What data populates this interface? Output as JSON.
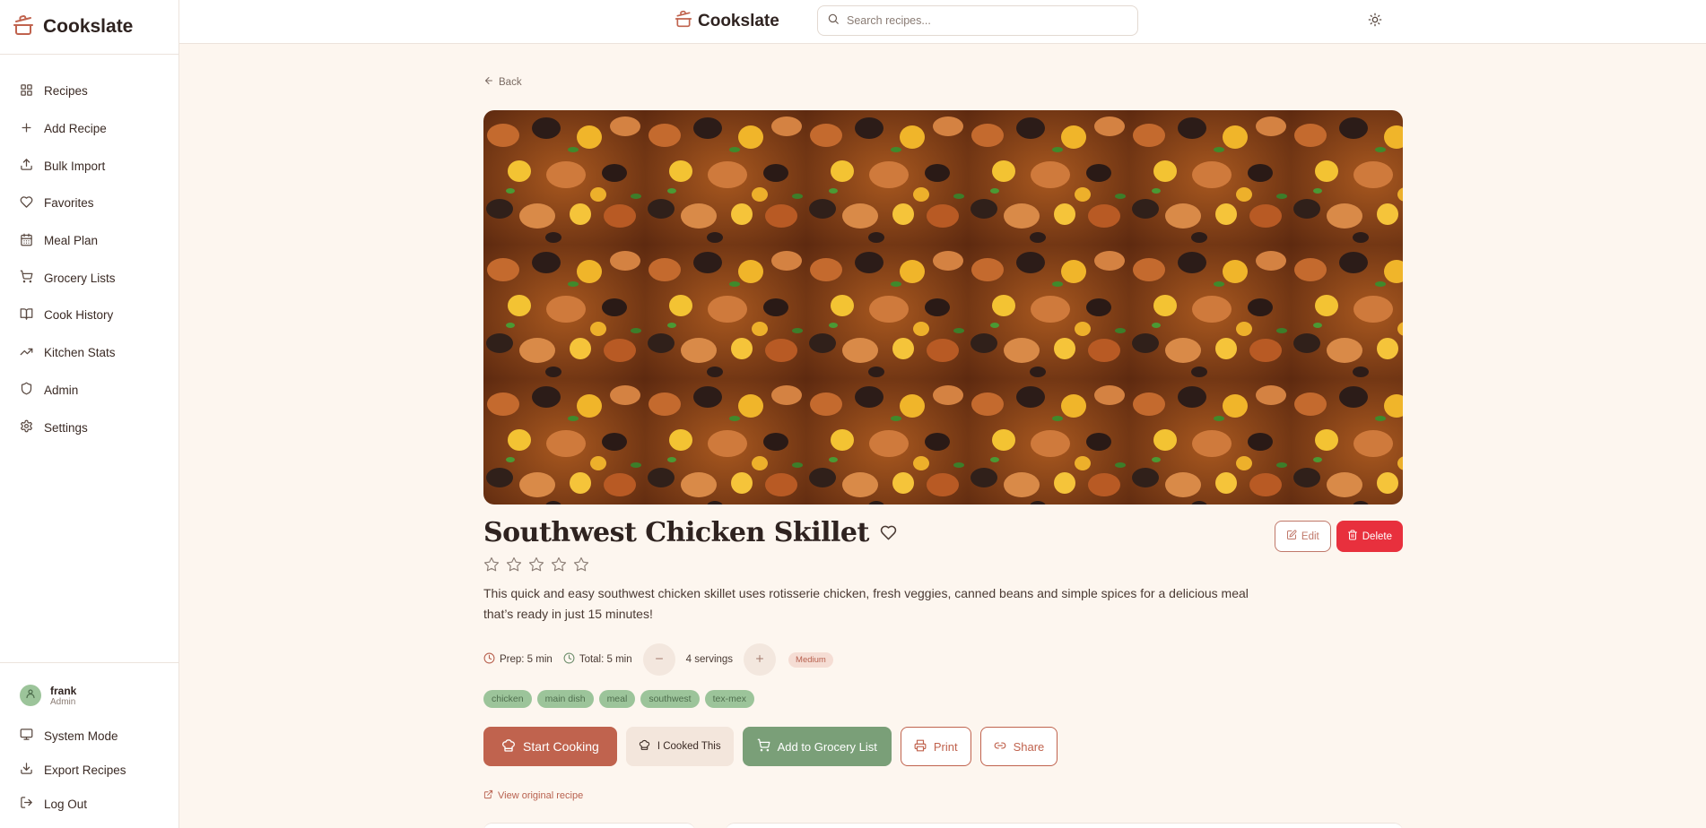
{
  "app": {
    "name": "Cookslate",
    "accent": "#c0634e",
    "icon": "cooking-pot-icon"
  },
  "sidebar": {
    "items": [
      {
        "label": "Recipes",
        "icon": "grid-icon"
      },
      {
        "label": "Add Recipe",
        "icon": "plus-icon"
      },
      {
        "label": "Bulk Import",
        "icon": "upload-icon"
      },
      {
        "label": "Favorites",
        "icon": "heart-icon"
      },
      {
        "label": "Meal Plan",
        "icon": "calendar-icon"
      },
      {
        "label": "Grocery Lists",
        "icon": "cart-icon"
      },
      {
        "label": "Cook History",
        "icon": "book-icon"
      },
      {
        "label": "Kitchen Stats",
        "icon": "trending-up-icon"
      },
      {
        "label": "Admin",
        "icon": "shield-icon"
      },
      {
        "label": "Settings",
        "icon": "gear-icon"
      }
    ],
    "user": {
      "name": "frank",
      "role": "Admin"
    },
    "bottom_items": [
      {
        "label": "System Mode",
        "icon": "monitor-icon"
      },
      {
        "label": "Export Recipes",
        "icon": "download-icon"
      },
      {
        "label": "Log Out",
        "icon": "logout-icon"
      }
    ]
  },
  "header": {
    "search_placeholder": "Search recipes...",
    "theme_icon": "sun-icon"
  },
  "recipe": {
    "back_label": "Back",
    "title": "Southwest Chicken Skillet",
    "description": "This quick and easy southwest chicken skillet uses rotisserie chicken, fresh veggies, canned beans and simple spices for a delicious meal that’s ready in just 15 minutes!",
    "rating": 0,
    "rating_max": 5,
    "prep": "Prep: 5 min",
    "total": "Total: 5 min",
    "servings": "4 servings",
    "difficulty": "Medium",
    "tags": [
      "chicken",
      "main dish",
      "meal",
      "southwest",
      "tex-mex"
    ],
    "edit_label": "Edit",
    "delete_label": "Delete",
    "start_label": "Start Cooking",
    "cooked_label": "I Cooked This",
    "grocery_label": "Add to Grocery List",
    "print_label": "Print",
    "share_label": "Share",
    "original_link": "View original recipe",
    "delete_color": "#e8303d",
    "grocery_color": "#7a9f78"
  }
}
